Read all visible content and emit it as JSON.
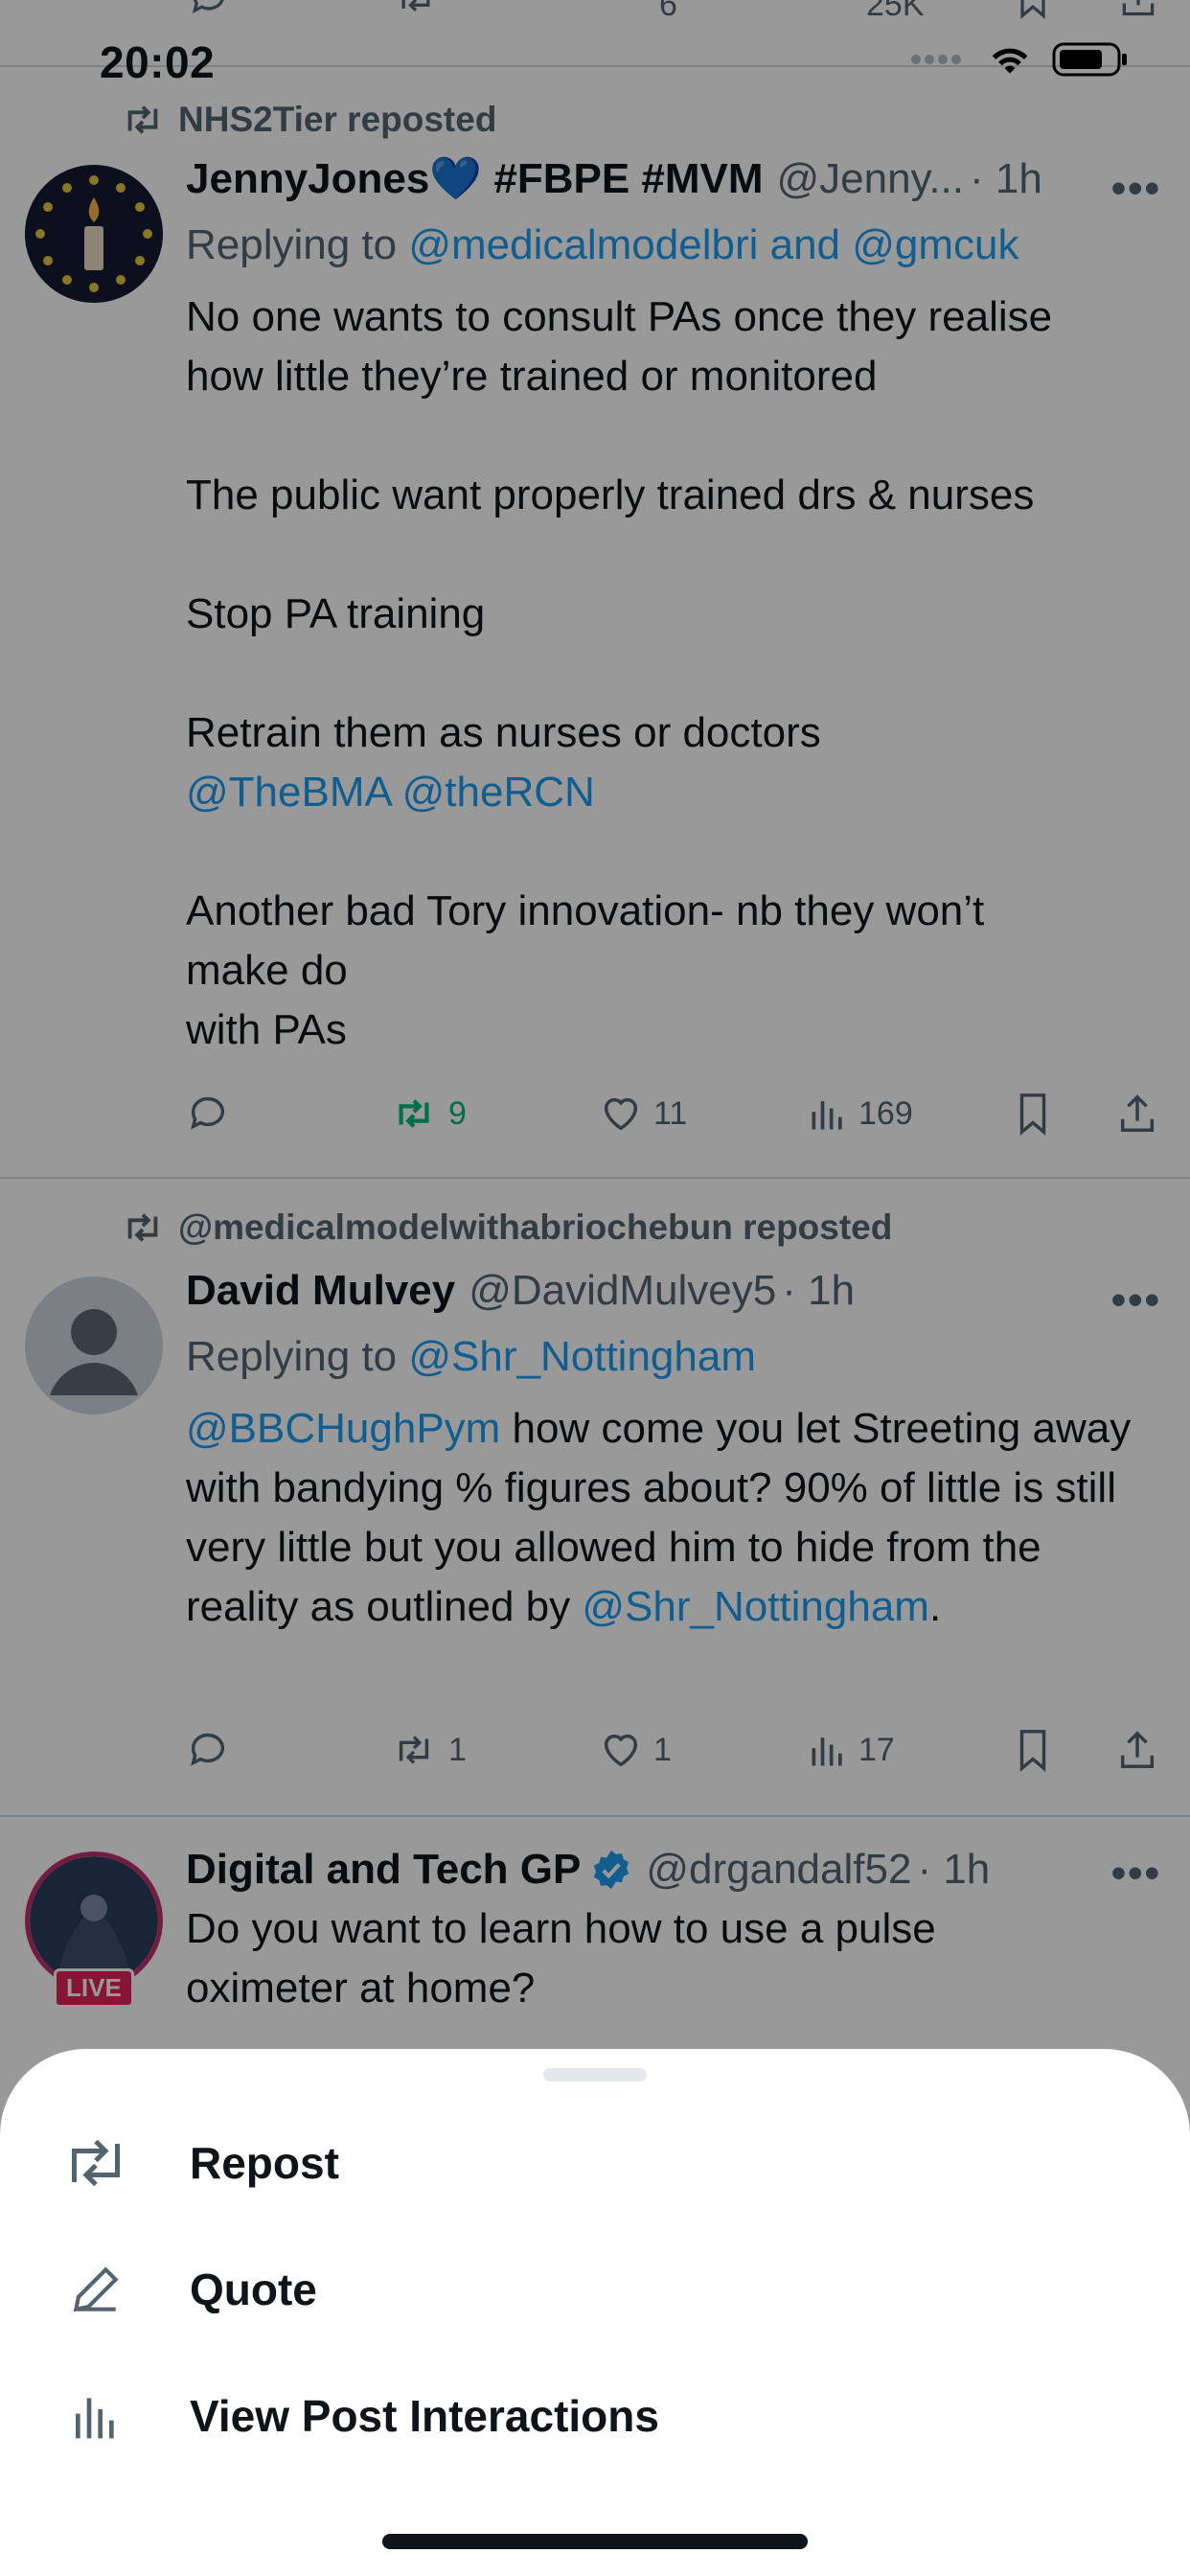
{
  "status_bar": {
    "time": "20:02"
  },
  "top_partial": {
    "reply_count": "6",
    "views": "25K"
  },
  "tweets": [
    {
      "repost_by": "NHS2Tier reposted",
      "name": "JennyJones💙 #FBPE #MVM",
      "handle": "@Jenny...",
      "time": "· 1h",
      "replying_prefix": "Replying to ",
      "replying_links": "@medicalmodelbri and @gmcuk",
      "body_1": "No one wants to consult PAs once they realise\nhow little they’re trained or monitored\n\nThe public want properly trained drs & nurses\n\nStop PA training\n\nRetrain them as nurses or doctors",
      "body_links": "@TheBMA @theRCN",
      "body_2": "Another bad Tory innovation- nb they won’t\nmake do\nwith PAs",
      "reposts": "9",
      "likes": "11",
      "views": "169"
    },
    {
      "repost_by": "@medicalmodelwithabriochebun reposted",
      "name": "David Mulvey",
      "handle": "@DavidMulvey5",
      "time": "· 1h",
      "replying_prefix": "Replying to ",
      "replying_links": "@Shr_Nottingham",
      "body_mention": "@BBCHughPym",
      "body_1": " how come you let Streeting away with bandying % figures about? 90% of little is still very little but you allowed him to hide from the reality as outlined by ",
      "body_mention_2": "@Shr_Nottingham",
      "body_2": ".",
      "reposts": "1",
      "likes": "1",
      "views": "17"
    },
    {
      "name": "Digital and Tech GP",
      "handle": "@drgandalf52",
      "time": "· 1h",
      "live_badge": "LIVE",
      "body_1": "Do you want to learn how to use a pulse\noximeter at home?"
    }
  ],
  "sheet": {
    "items": [
      {
        "label": "Repost",
        "icon": "repost-icon"
      },
      {
        "label": "Quote",
        "icon": "pencil-icon"
      },
      {
        "label": "View Post Interactions",
        "icon": "bar-chart-icon"
      }
    ]
  },
  "colors": {
    "accent": "#1d9bf0",
    "repost_green": "#00ba7c",
    "muted": "#536471",
    "overlay": "rgba(0,0,0,0.4)"
  }
}
